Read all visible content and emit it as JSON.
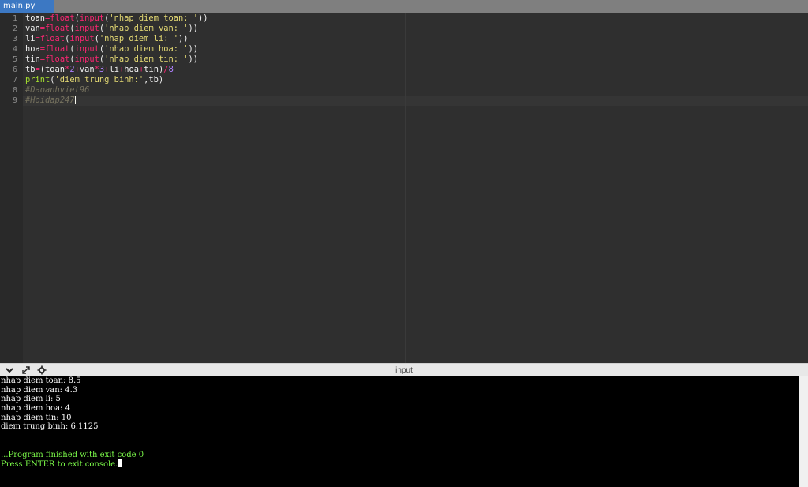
{
  "tab": {
    "label": "main.py"
  },
  "editor": {
    "line_numbers": [
      "1",
      "2",
      "3",
      "4",
      "5",
      "6",
      "7",
      "8",
      "9"
    ],
    "lines": {
      "l1": {
        "var": "toan",
        "eq": "=",
        "fn1": "float",
        "p1": "(",
        "fn2": "input",
        "p2": "(",
        "str": "'nhap diem toan: '",
        "close": "))"
      },
      "l2": {
        "var": "van",
        "eq": "=",
        "fn1": "float",
        "p1": "(",
        "fn2": "input",
        "p2": "(",
        "str": "'nhap diem van: '",
        "close": "))"
      },
      "l3": {
        "var": "li",
        "eq": "=",
        "fn1": "float",
        "p1": "(",
        "fn2": "input",
        "p2": "(",
        "str": "'nhap diem li: '",
        "close": "))"
      },
      "l4": {
        "var": "hoa",
        "eq": "=",
        "fn1": "float",
        "p1": "(",
        "fn2": "input",
        "p2": "(",
        "str": "'nhap diem hoa: '",
        "close": "))"
      },
      "l5": {
        "var": "tin",
        "eq": "=",
        "fn1": "float",
        "p1": "(",
        "fn2": "input",
        "p2": "(",
        "str": "'nhap diem tin: '",
        "close": "))"
      },
      "l6": {
        "a": "tb",
        "eq": "=",
        "b": "(toan",
        "op1": "*",
        "n1": "2",
        "op2": "+",
        "c": "van",
        "op3": "*",
        "n2": "3",
        "op4": "+",
        "d": "li",
        "op5": "+",
        "e": "hoa",
        "op6": "+",
        "f": "tin)",
        "op7": "/",
        "n3": "8"
      },
      "l7": {
        "fn": "print",
        "p": "(",
        "str": "'diem trung binh:'",
        "rest": ",tb)"
      },
      "l8": {
        "comment": "#Daoanhviet96"
      },
      "l9": {
        "comment": "#Hoidap247"
      }
    }
  },
  "console": {
    "title": "input",
    "icons": [
      "chevron-down-icon",
      "expand-icon",
      "settings-icon"
    ],
    "output": [
      "nhap diem toan: 8.5",
      "nhap diem van: 4.3",
      "nhap diem li: 5",
      "nhap diem hoa: 4",
      "nhap diem tin: 10",
      "diem trung binh: 6.1125"
    ],
    "finished": "...Program finished with exit code 0",
    "prompt": "Press ENTER to exit console."
  },
  "colors": {
    "tab_active": "#3c78c3",
    "editor_bg": "#2f2f2f",
    "console_bg": "#000000",
    "console_green": "#7cfc4a"
  }
}
